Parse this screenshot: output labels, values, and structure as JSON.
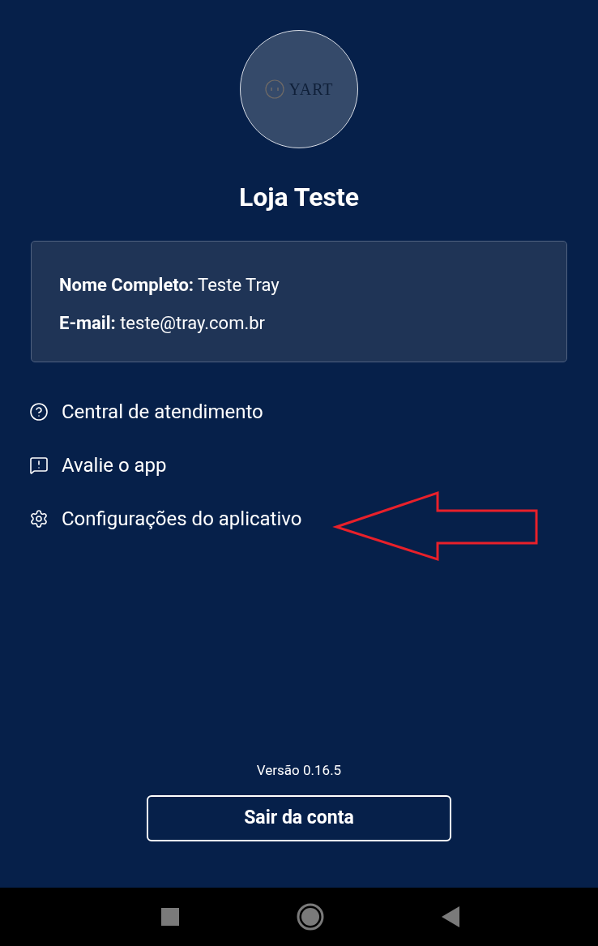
{
  "profile": {
    "logo_text": "YART",
    "store_name": "Loja Teste"
  },
  "account_card": {
    "lines": [
      "**Nome Completo:** Teste Tray",
      "**E-mail:** teste@tray.com.br"
    ]
  },
  "menu": [
    {
      "kind": "help",
      "label": "Central de atendimento"
    },
    {
      "kind": "feedback",
      "label": "Avalie o app"
    },
    {
      "kind": "settings",
      "label": "Configurações do aplicativo"
    }
  ],
  "version": "Versão 0.16.5",
  "logout_button": "Sair da conta"
}
